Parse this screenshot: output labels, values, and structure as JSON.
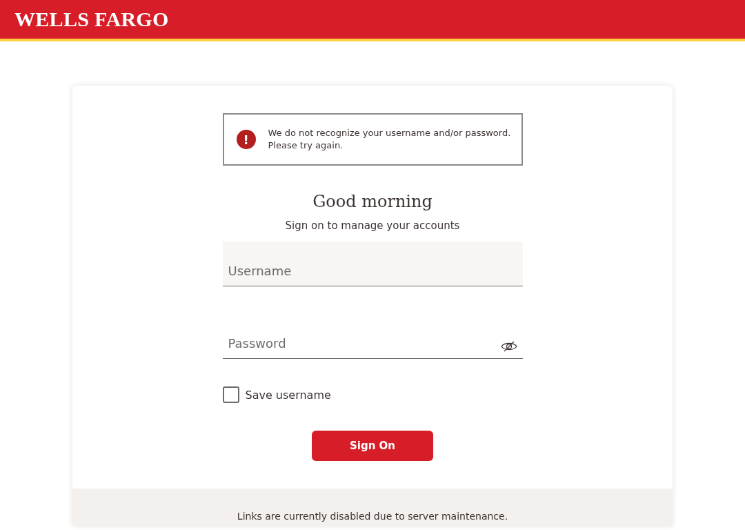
{
  "header": {
    "logo": "WELLS FARGO"
  },
  "alert": {
    "icon": "!",
    "message": "We do not recognize your username and/or password.",
    "hint": "Please try again."
  },
  "heading": "Good morning",
  "subtitle": "Sign on to manage your accounts",
  "fields": [
    {
      "kind": "text",
      "placeholder": "Username",
      "focused": true
    },
    {
      "kind": "password",
      "placeholder": "Password",
      "focused": false
    }
  ],
  "save_username": {
    "label": "Save username",
    "checked": false
  },
  "button": "Sign On",
  "footer": {
    "notice": "Links are currently disabled due to server maintenance."
  }
}
